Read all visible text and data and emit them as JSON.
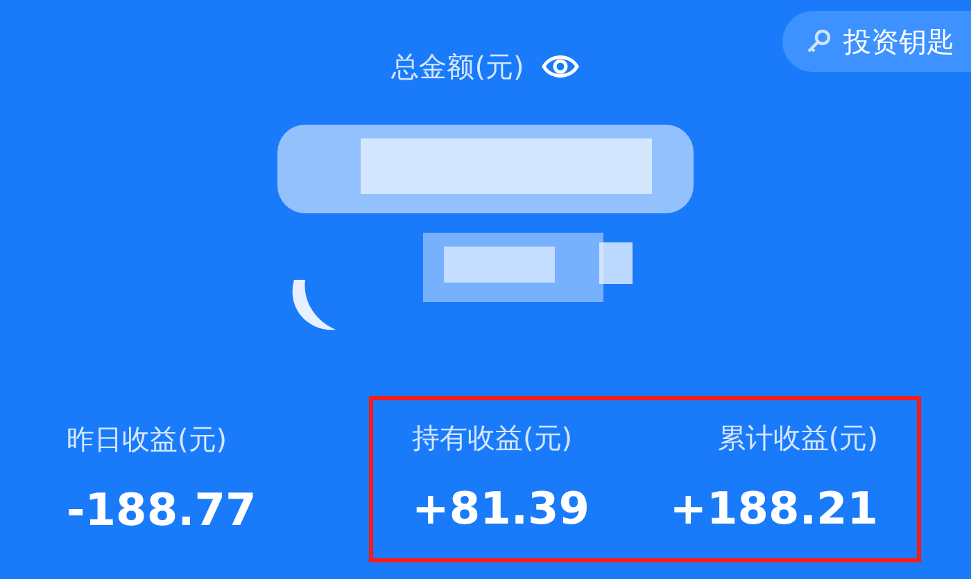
{
  "header": {
    "title": "总金额(元)"
  },
  "key_button": {
    "label": "投资钥匙"
  },
  "stats": [
    {
      "label": "昨日收益(元)",
      "value": "-188.77"
    }
  ],
  "highlight_frame": {
    "stats": [
      {
        "label": "持有收益(元)",
        "value": "+81.39"
      },
      {
        "label": "累计收益(元)",
        "value": "+188.21"
      }
    ]
  }
}
